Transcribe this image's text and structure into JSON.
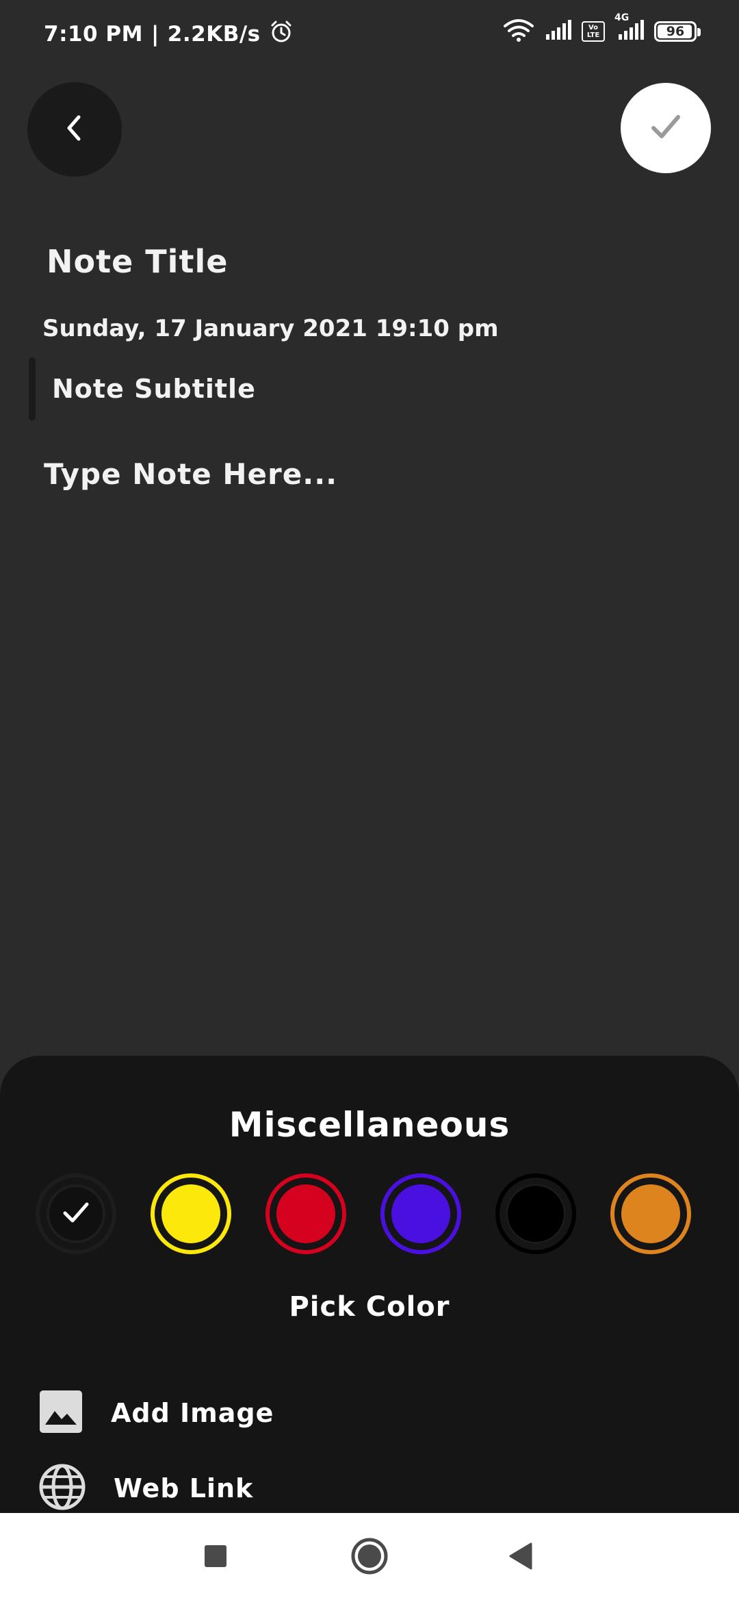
{
  "status_bar": {
    "time": "7:10 PM",
    "speed": "2.2KB/s",
    "separator": "|",
    "network_type": "4G",
    "volte_label": "Vo\nLTE",
    "battery_level": "96"
  },
  "header": {
    "back_icon": "chevron-left-icon",
    "save_icon": "check-icon"
  },
  "note": {
    "title_placeholder": "Note Title",
    "datetime": "Sunday, 17 January 2021 19:10 pm",
    "subtitle_placeholder": "Note Subtitle",
    "body_placeholder": "Type Note Here..."
  },
  "misc_sheet": {
    "title": "Miscellaneous",
    "pick_color_label": "Pick Color",
    "colors": [
      {
        "name": "default",
        "ring": "#1d1d1d",
        "fill": "#101010",
        "selected": true
      },
      {
        "name": "yellow",
        "ring": "#fde80c",
        "fill": "#fde80c",
        "selected": false
      },
      {
        "name": "red",
        "ring": "#d4021e",
        "fill": "#d4021e",
        "selected": false
      },
      {
        "name": "blue",
        "ring": "#4a10e0",
        "fill": "#4a10e0",
        "selected": false
      },
      {
        "name": "black",
        "ring": "#000000",
        "fill": "#000000",
        "selected": false
      },
      {
        "name": "orange",
        "ring": "#dd841f",
        "fill": "#dd841f",
        "selected": false
      }
    ],
    "actions": [
      {
        "label": "Add Image",
        "icon": "image-icon"
      },
      {
        "label": "Web Link",
        "icon": "globe-icon"
      }
    ]
  },
  "nav_bar": {
    "recents_icon": "square-icon",
    "home_icon": "circle-icon",
    "back_icon": "triangle-back-icon"
  }
}
